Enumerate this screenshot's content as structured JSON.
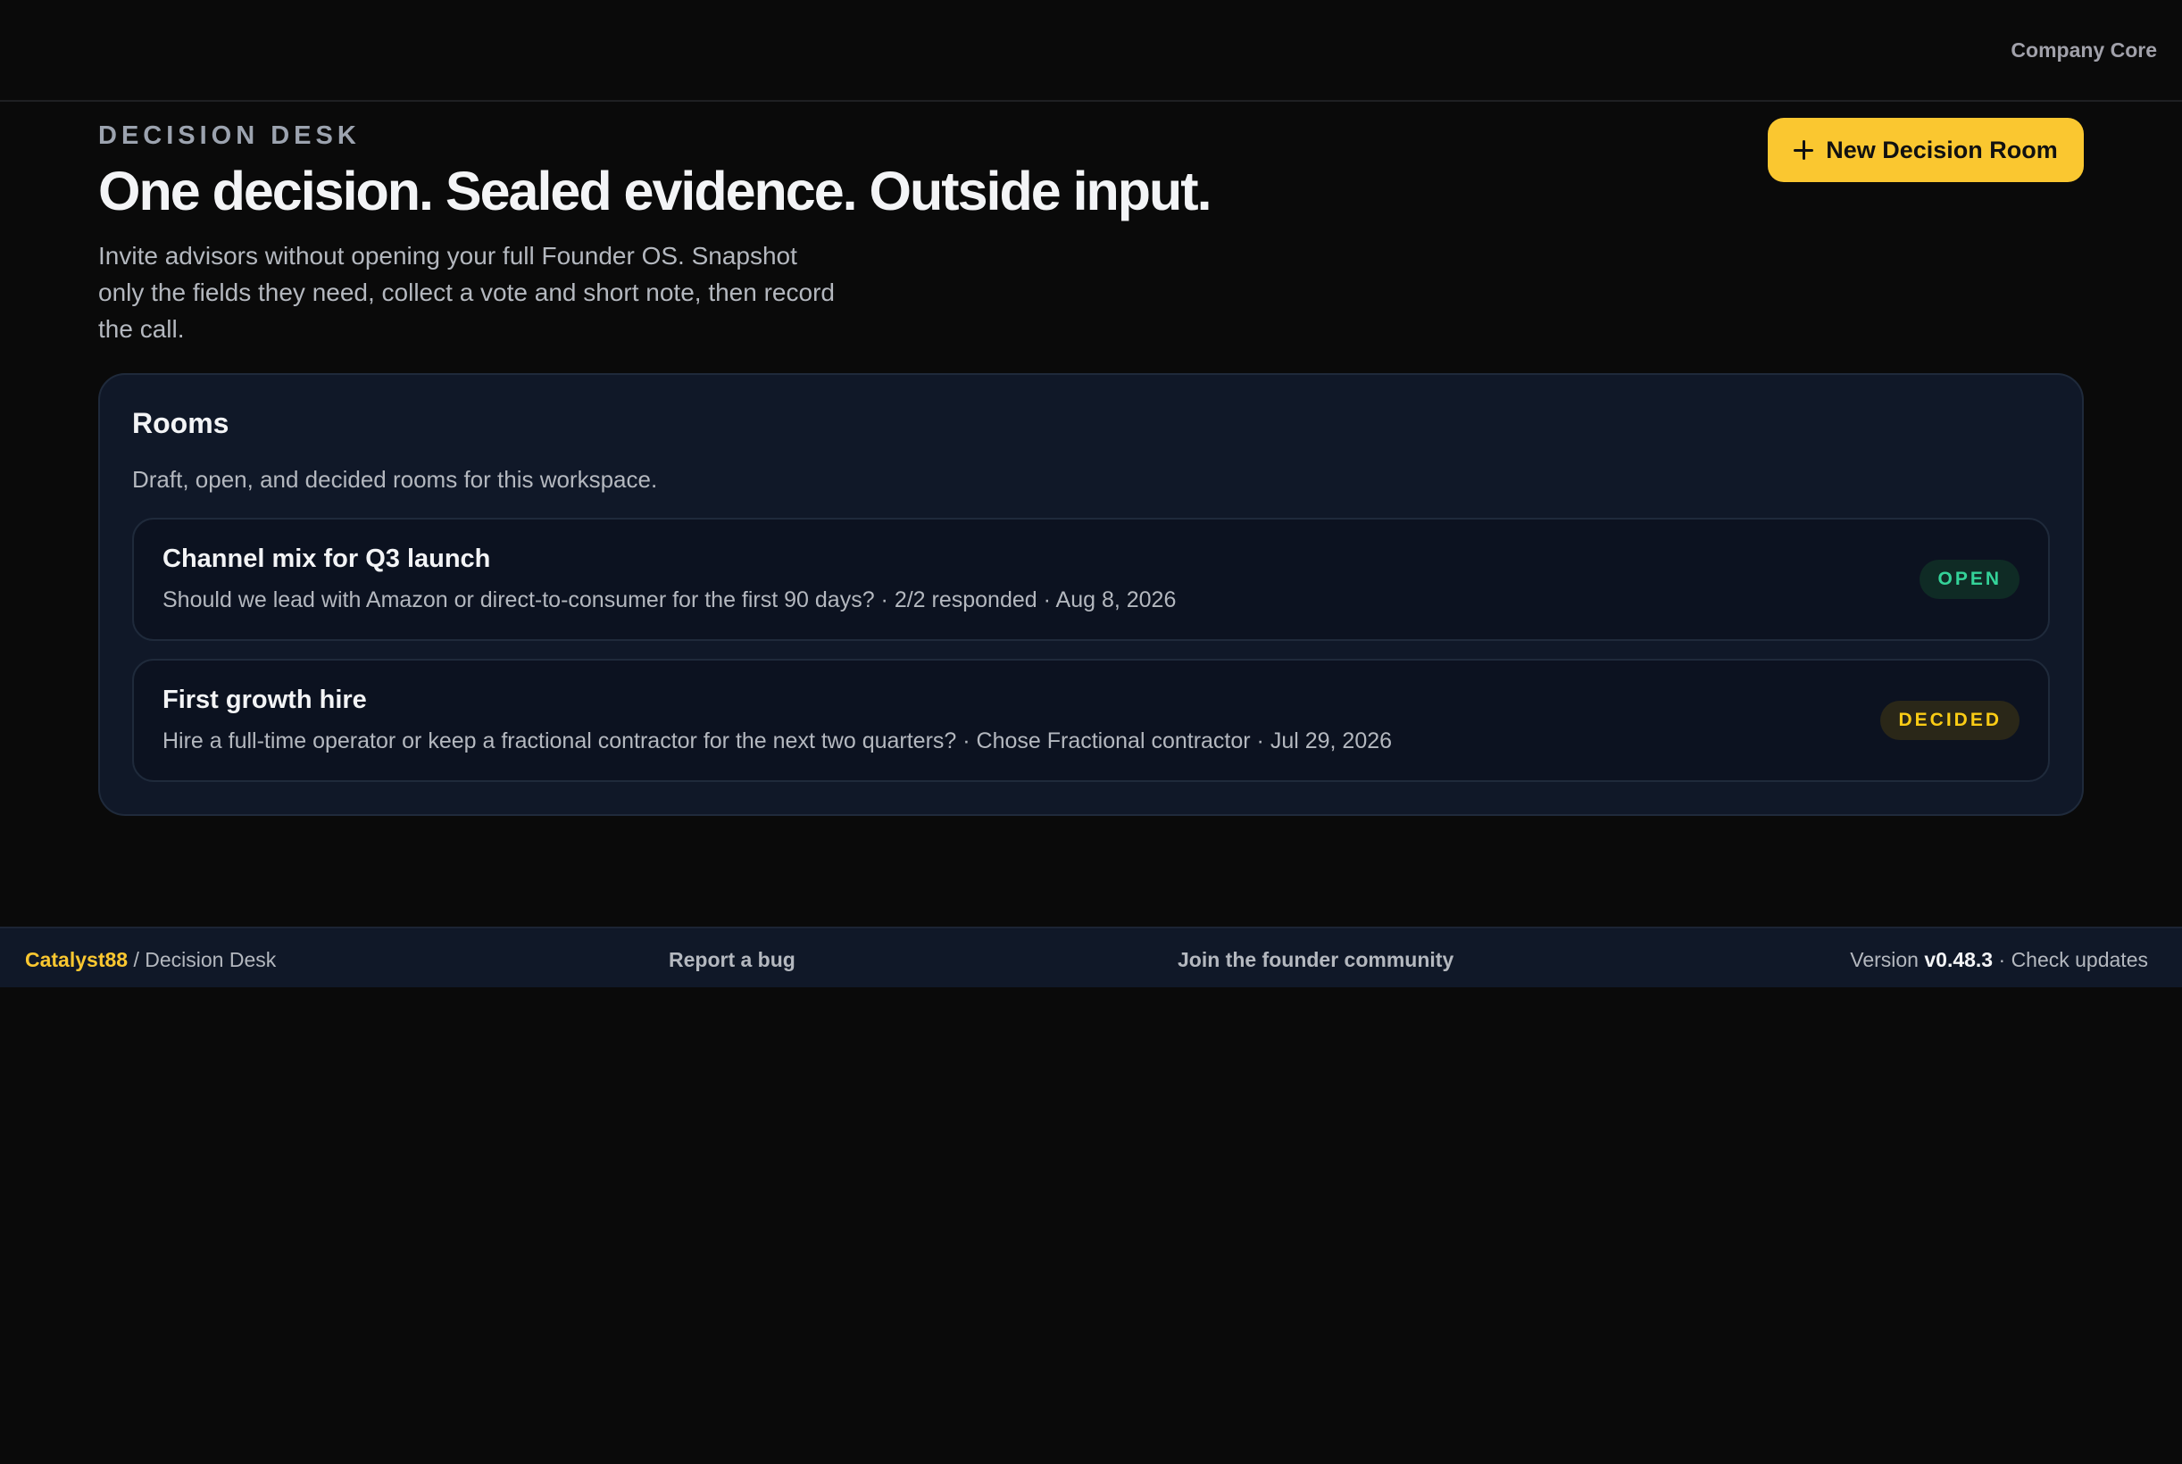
{
  "topbar": {
    "workspace": "Company Core"
  },
  "header": {
    "eyebrow": "DECISION DESK",
    "title": "One decision. Sealed evidence. Outside input.",
    "subtitle": "Invite advisors without opening your full Founder OS. Snapshot only the fields they need, collect a vote and short note, then record the call.",
    "new_room_label": "New Decision Room"
  },
  "rooms": {
    "title": "Rooms",
    "description": "Draft, open, and decided rooms for this workspace.",
    "items": [
      {
        "title": "Channel mix for Q3 launch",
        "meta": "Should we lead with Amazon or direct-to-consumer for the first 90 days? · 2/2 responded · Aug 8, 2026",
        "status": "OPEN"
      },
      {
        "title": "First growth hire",
        "meta": "Hire a full-time operator or keep a fractional contractor for the next two quarters? · Chose Fractional contractor · Jul 29, 2026",
        "status": "DECIDED"
      }
    ]
  },
  "footer": {
    "brand": "Catalyst88",
    "separator": " / ",
    "product": "Decision Desk",
    "report_bug": "Report a bug",
    "community": "Join the founder community",
    "version_label": "Version ",
    "version_number": "v0.48.3",
    "version_sep": " · ",
    "check_updates": "Check updates"
  },
  "colors": {
    "background": "#0a0a0a",
    "panel": "#101828",
    "accent": "#fac730",
    "open_status": "#34d399",
    "decided_status": "#facc15"
  },
  "icons": {
    "new_room": "plus-icon"
  }
}
